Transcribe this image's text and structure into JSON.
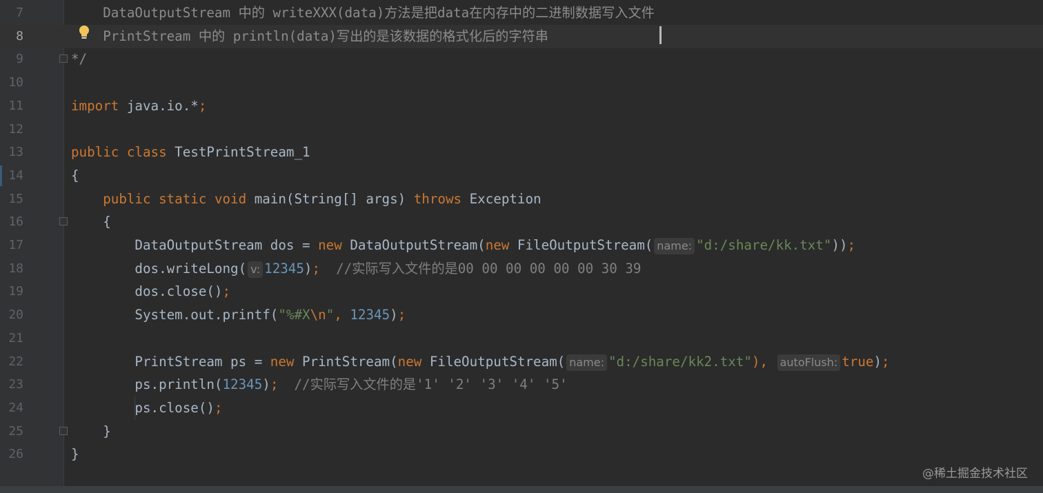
{
  "lines": [
    {
      "n": "7",
      "tokens": [
        {
          "t": "    DataOutputStream 中的 writeXXX(data)方法是把data在内存中的二进制数据写入文件",
          "c": "doc"
        }
      ]
    },
    {
      "n": "8",
      "tokens": [
        {
          "t": "    PrintStream 中的 println(data)写出的是该数据的格式化后的字符串",
          "c": "doc"
        }
      ],
      "current": true
    },
    {
      "n": "9",
      "tokens": [
        {
          "t": "*/",
          "c": "doc"
        }
      ]
    },
    {
      "n": "10",
      "tokens": []
    },
    {
      "n": "11",
      "tokens": [
        {
          "t": "import",
          "c": "kw"
        },
        {
          "t": " java.io.*"
        },
        {
          "t": ";",
          "c": "kw"
        }
      ]
    },
    {
      "n": "12",
      "tokens": []
    },
    {
      "n": "13",
      "tokens": [
        {
          "t": "public class",
          "c": "kw"
        },
        {
          "t": " TestPrintStream_1"
        }
      ]
    },
    {
      "n": "14",
      "tokens": [
        {
          "t": "{"
        }
      ]
    },
    {
      "n": "15",
      "tokens": [
        {
          "t": "    "
        },
        {
          "t": "public static void",
          "c": "kw"
        },
        {
          "t": " main(String[] args) "
        },
        {
          "t": "throws",
          "c": "kw"
        },
        {
          "t": " Exception"
        }
      ]
    },
    {
      "n": "16",
      "tokens": [
        {
          "t": "    {"
        }
      ]
    },
    {
      "n": "17",
      "tokens": [
        {
          "t": "        DataOutputStream dos = "
        },
        {
          "t": "new",
          "c": "kw"
        },
        {
          "t": " DataOutputStream("
        },
        {
          "t": "new",
          "c": "kw"
        },
        {
          "t": " FileOutputStream("
        },
        {
          "t": "name:",
          "c": "hint"
        },
        {
          "t": "\"d:/share/kk.txt\"",
          "c": "str"
        },
        {
          "t": "))"
        },
        {
          "t": ";",
          "c": "kw"
        }
      ]
    },
    {
      "n": "18",
      "tokens": [
        {
          "t": "        dos.writeLong("
        },
        {
          "t": "v:",
          "c": "hint"
        },
        {
          "t": "12345",
          "c": "num"
        },
        {
          "t": ")"
        },
        {
          "t": ";",
          "c": "kw"
        },
        {
          "t": "  //实际写入文件的是00 00 00 00 00 00 30 39",
          "c": "cmt"
        }
      ]
    },
    {
      "n": "19",
      "tokens": [
        {
          "t": "        dos.close()"
        },
        {
          "t": ";",
          "c": "kw"
        }
      ]
    },
    {
      "n": "20",
      "tokens": [
        {
          "t": "        System.out.printf("
        },
        {
          "t": "\"%#X",
          "c": "str"
        },
        {
          "t": "\\n",
          "c": "kw"
        },
        {
          "t": "\"",
          "c": "str"
        },
        {
          "t": ", ",
          "c": "kw"
        },
        {
          "t": "12345",
          "c": "num"
        },
        {
          "t": ")"
        },
        {
          "t": ";",
          "c": "kw"
        }
      ]
    },
    {
      "n": "21",
      "tokens": []
    },
    {
      "n": "22",
      "tokens": [
        {
          "t": "        PrintStream ps = "
        },
        {
          "t": "new",
          "c": "kw"
        },
        {
          "t": " PrintStream("
        },
        {
          "t": "new",
          "c": "kw"
        },
        {
          "t": " FileOutputStream("
        },
        {
          "t": "name:",
          "c": "hint"
        },
        {
          "t": "\"d:/share/kk2.txt\"",
          "c": "str"
        },
        {
          "t": "), ",
          "c": "kw"
        },
        {
          "t": "autoFlush:",
          "c": "hint"
        },
        {
          "t": "true",
          "c": "kw"
        },
        {
          "t": ")"
        },
        {
          "t": ";",
          "c": "kw"
        }
      ]
    },
    {
      "n": "23",
      "tokens": [
        {
          "t": "        ps.println("
        },
        {
          "t": "12345",
          "c": "num"
        },
        {
          "t": ")"
        },
        {
          "t": ";",
          "c": "kw"
        },
        {
          "t": "  //实际写入文件的是'1' '2' '3' '4' '5'",
          "c": "cmt"
        }
      ]
    },
    {
      "n": "24",
      "tokens": [
        {
          "t": "        ps.close()"
        },
        {
          "t": ";",
          "c": "kw"
        }
      ]
    },
    {
      "n": "25",
      "tokens": [
        {
          "t": "    }"
        }
      ]
    },
    {
      "n": "26",
      "tokens": [
        {
          "t": "}"
        }
      ]
    }
  ],
  "watermark": "@稀土掘金技术社区",
  "colors": {
    "background": "#2b2b2b",
    "keyword": "#cc7832",
    "string": "#6a8759",
    "number": "#6897bb",
    "comment": "#808080",
    "text": "#a9b7c6"
  },
  "icons": {
    "bulb": "lightbulb-icon",
    "fold": "fold-marker-icon"
  }
}
